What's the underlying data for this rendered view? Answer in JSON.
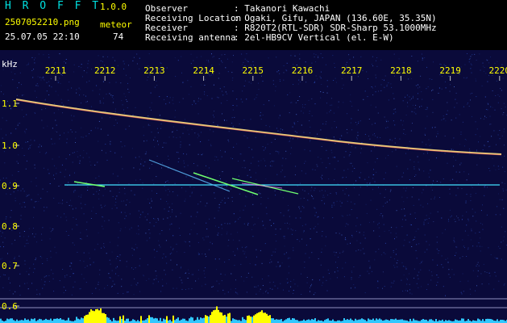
{
  "app": {
    "name": "H R O F F T",
    "version": "1.0.0",
    "filename": "2507052210.png",
    "datetime": "25.07.05 22:10",
    "meteor_label": "meteor",
    "meteor_count": "74"
  },
  "info": {
    "observer_label": "Observer",
    "observer_value": ": Takanori Kawachi",
    "location_label": "Receiving Location",
    "location_value": ": Ogaki, Gifu, JAPAN (136.60E, 35.35N)",
    "receiver_label": "Receiver",
    "receiver_value": ": R820T2(RTL-SDR) SDR-Sharp 53.1000MHz",
    "antenna_label": "Receiving antenna",
    "antenna_value": ": 2el-HB9CV Vertical (el. E-W)"
  },
  "axis": {
    "unit": "kHz",
    "time_ticks": [
      "2211",
      "2212",
      "2213",
      "2214",
      "2215",
      "2216",
      "2217",
      "2218",
      "2219",
      "2220"
    ],
    "freq_ticks": [
      "1.1",
      "1.0",
      "0.9",
      "0.8",
      "0.7",
      "0.6"
    ]
  },
  "colors": {
    "background": "#0a0a3a",
    "header_text": "#ffffff",
    "title_text": "#00e0e0",
    "tick_text": "#ffff00",
    "carrier_line": "#40e0ff",
    "meteor_trace": "#70ff70",
    "histogram": "#ffff00"
  }
}
